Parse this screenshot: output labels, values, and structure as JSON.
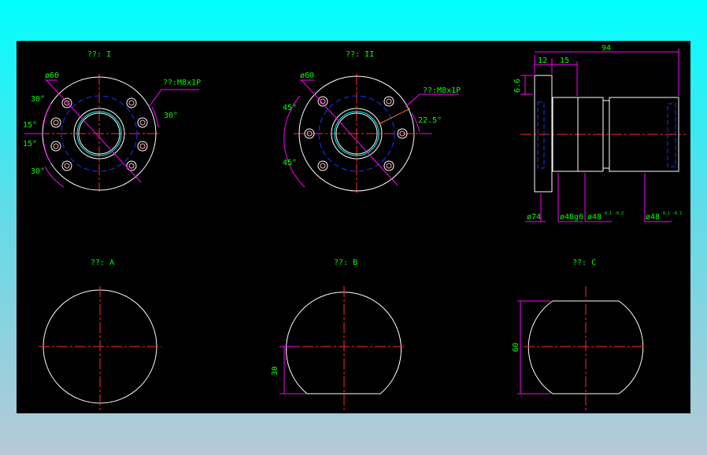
{
  "views": {
    "view1_title": "??: I",
    "view2_title": "??: II",
    "viewA_title": "??: A",
    "viewB_title": "??: B",
    "viewC_title": "??: C"
  },
  "dims": {
    "v1_dia": "ø60",
    "v1_thread": "??:M8x1P",
    "v1_ang_30_top": "30°",
    "v1_ang_15_a": "15°",
    "v1_ang_15_b": "15°",
    "v1_ang_30_bot": "30°",
    "v1_ang_30_right": "30°",
    "v2_dia": "ø60",
    "v2_thread": "??:M8x1P",
    "v2_ang_45_top": "45°",
    "v2_ang_45_bot": "45°",
    "v2_ang_22": "22.5°",
    "side_94": "94",
    "side_12": "12",
    "side_15": "15",
    "side_66": "6.6",
    "side_d74": "ø74",
    "side_d48g6": "ø48g6",
    "side_d48a": "ø48",
    "side_d48a_tol": "-0.1 -0.2",
    "side_d48b": "ø48",
    "side_d48b_tol": "-0.1 -0.2",
    "b_30": "30",
    "c_60": "60"
  },
  "colors": {
    "outline": "#ffffff",
    "centerline": "#ff2a2a",
    "hidden": "#1a35ff",
    "dimension": "#ff00ff",
    "text": "#00ff00",
    "bolt": "#ffb0b0",
    "leader": "#ff7a1a",
    "background": "#000000"
  }
}
